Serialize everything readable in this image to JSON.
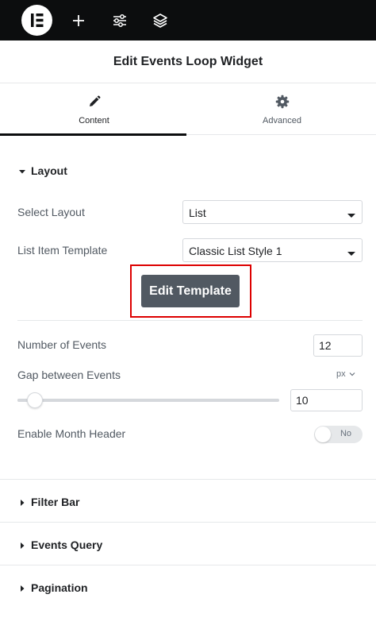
{
  "topbar": {
    "icons": [
      "elementor-logo-icon",
      "plus-icon",
      "sliders-icon",
      "layers-icon"
    ]
  },
  "panel": {
    "title": "Edit Events Loop Widget"
  },
  "tabs": [
    {
      "label": "Content",
      "icon": "pencil-icon",
      "active": true
    },
    {
      "label": "Advanced",
      "icon": "gear-icon",
      "active": false
    }
  ],
  "layout": {
    "title": "Layout",
    "select_layout_label": "Select Layout",
    "select_layout_value": "List",
    "template_label": "List Item Template",
    "template_value": "Classic List Style 1",
    "edit_template_label": "Edit Template",
    "events_label": "Number of Events",
    "events_value": "12",
    "gap_label": "Gap between Events",
    "gap_unit": "px",
    "gap_value": "10",
    "month_header_label": "Enable Month Header",
    "month_header_state": "No"
  },
  "sections": {
    "filter_bar": "Filter Bar",
    "events_query": "Events Query",
    "pagination": "Pagination"
  },
  "colors": {
    "topbar_bg": "#0c0d0e",
    "highlight": "#dd0000",
    "button_bg": "#515962"
  }
}
